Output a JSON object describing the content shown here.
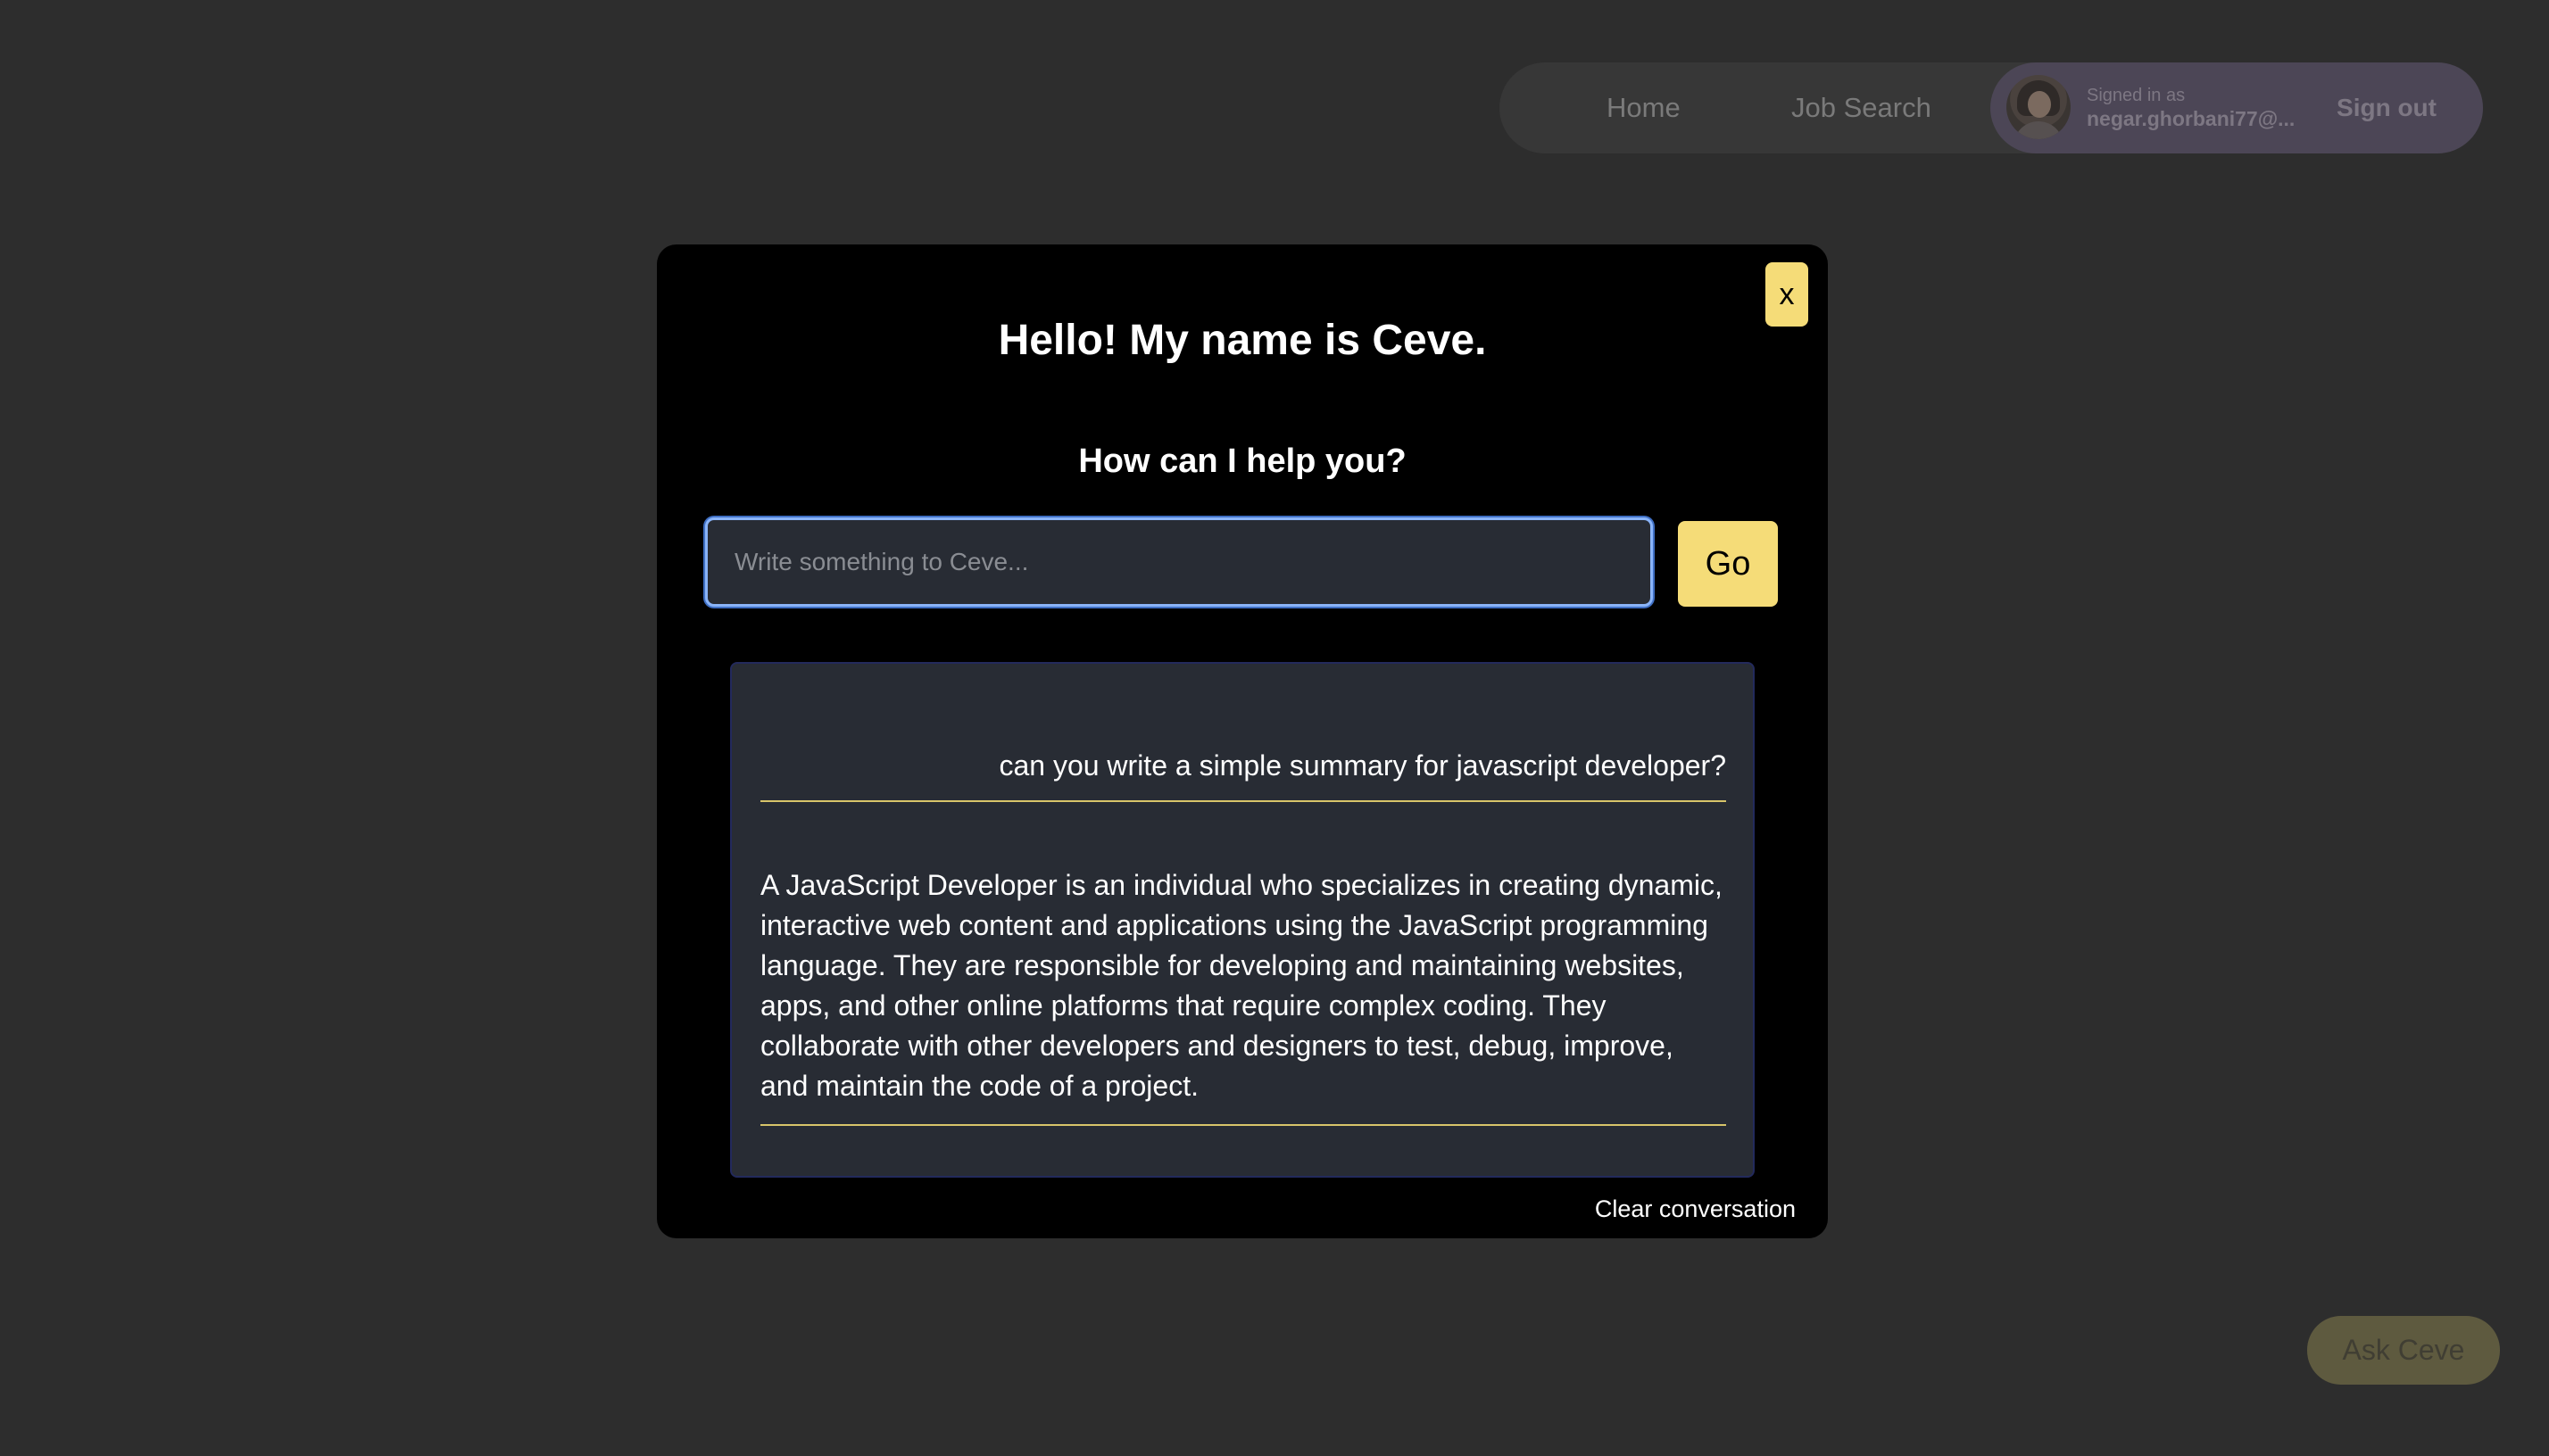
{
  "nav": {
    "home_label": "Home",
    "job_search_label": "Job Search",
    "account": {
      "signed_in_label": "Signed in as",
      "email": "negar.ghorbani77@...",
      "sign_out_label": "Sign out"
    }
  },
  "modal": {
    "close_label": "x",
    "title": "Hello! My name is Ceve.",
    "subtitle": "How can I help you?",
    "input": {
      "value": "",
      "placeholder": "Write something to Ceve..."
    },
    "go_label": "Go",
    "conversation": {
      "messages": [
        {
          "role": "user",
          "text": "can you write a simple summary for javascript developer?"
        },
        {
          "role": "assistant",
          "text": "A JavaScript Developer is an individual who specializes in creating dynamic, interactive web content and applications using the JavaScript programming language. They are responsible for developing and maintaining websites, apps, and other online platforms that require complex coding. They collaborate with other developers and designers to test, debug, improve, and maintain the code of a project."
        }
      ]
    },
    "clear_label": "Clear conversation"
  },
  "ask_button_label": "Ask Ceve",
  "colors": {
    "page_background": "#2d2d2d",
    "modal_background": "#000000",
    "accent_yellow": "#f5dc78",
    "panel_background": "#282c34",
    "focus_ring": "#8ab4f8"
  }
}
